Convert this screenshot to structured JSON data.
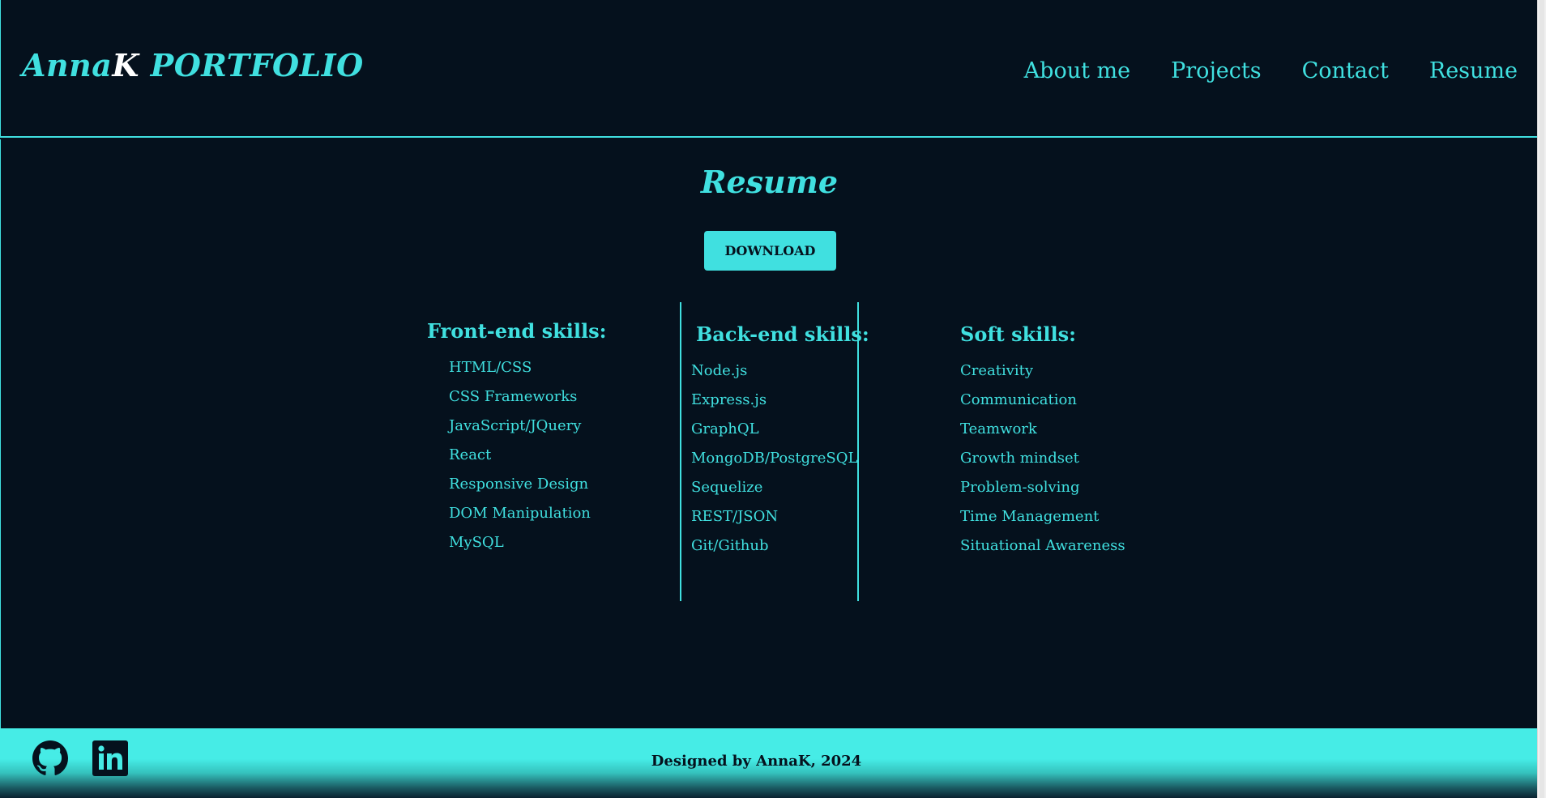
{
  "colors": {
    "background": "#05111d",
    "accent": "#40e0e0",
    "logo_highlight": "#ffffff",
    "footer": "#46ece6"
  },
  "header": {
    "logo_prefix": "Anna",
    "logo_k": "K",
    "logo_suffix": " PORTFOLIO",
    "nav": [
      {
        "label": "About me"
      },
      {
        "label": "Projects"
      },
      {
        "label": "Contact"
      },
      {
        "label": "Resume"
      }
    ]
  },
  "main": {
    "title": "Resume",
    "download_label": "DOWNLOAD",
    "columns": {
      "front": {
        "heading": "Front-end skills:",
        "items": [
          "HTML/CSS",
          "CSS Frameworks",
          "JavaScript/JQuery",
          "React",
          "Responsive Design",
          "DOM Manipulation",
          "MySQL"
        ]
      },
      "back": {
        "heading": "Back-end skills:",
        "items": [
          "Node.js",
          "Express.js",
          "GraphQL",
          "MongoDB/PostgreSQL",
          "Sequelize",
          "REST/JSON",
          "Git/Github"
        ]
      },
      "soft": {
        "heading": "Soft skills:",
        "items": [
          "Creativity",
          "Communication",
          "Teamwork",
          "Growth mindset",
          "Problem-solving",
          "Time Management",
          "Situational Awareness"
        ]
      }
    }
  },
  "footer": {
    "icons": [
      "github-icon",
      "linkedin-icon"
    ],
    "credit": "Designed by AnnaK, 2024"
  }
}
